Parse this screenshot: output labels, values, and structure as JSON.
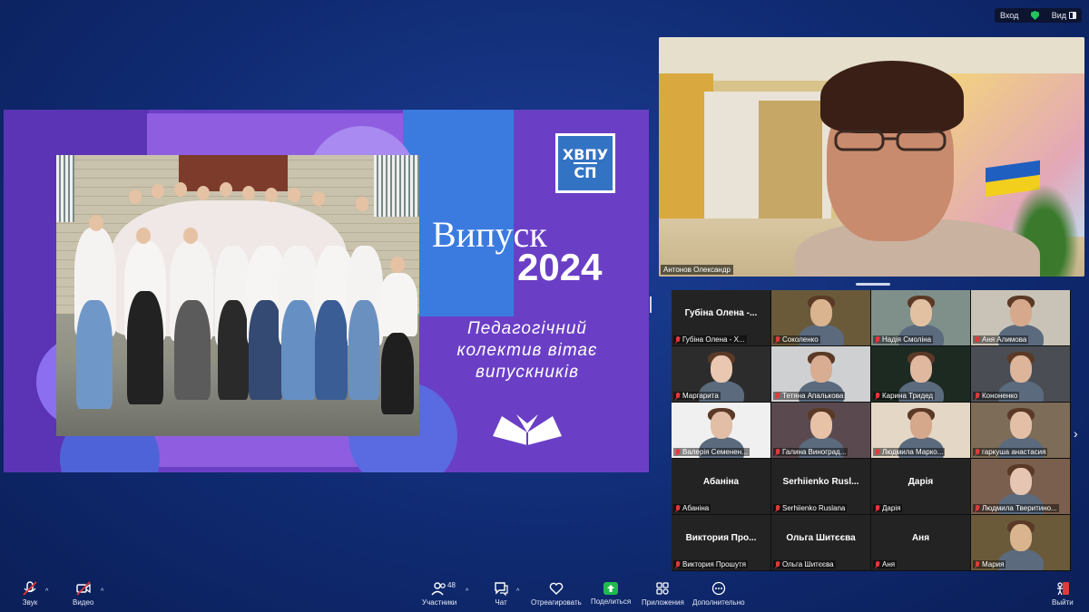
{
  "status_bar": {
    "login_label": "Вход",
    "view_label": "Вид"
  },
  "slide": {
    "logo_line1": "ХВПУ",
    "logo_line2": "СП",
    "title": "Випуск",
    "year": "2024",
    "tagline_1": "Педагогічний",
    "tagline_2": "колектив вітає",
    "tagline_3": "випускників"
  },
  "speaker": {
    "name": "Антонов Олександр"
  },
  "gallery": {
    "tiles": [
      {
        "display": "Губіна Олена -...",
        "caption": "Губіна Олена - Х...",
        "has_video": false
      },
      {
        "display": "",
        "caption": "Соколенко",
        "has_video": true
      },
      {
        "display": "",
        "caption": "Надія Смоліна",
        "has_video": true
      },
      {
        "display": "",
        "caption": "Аня Алимова",
        "has_video": true
      },
      {
        "display": "",
        "caption": "Маргарита",
        "has_video": true
      },
      {
        "display": "",
        "caption": "Тетяна Апалькова",
        "has_video": true
      },
      {
        "display": "",
        "caption": "Карина Тридед",
        "has_video": true
      },
      {
        "display": "",
        "caption": "Кононенко",
        "has_video": true
      },
      {
        "display": "",
        "caption": "Валерія Семенен...",
        "has_video": true
      },
      {
        "display": "",
        "caption": "Галина Виноград...",
        "has_video": true
      },
      {
        "display": "",
        "caption": "Людмила Марко...",
        "has_video": true
      },
      {
        "display": "",
        "caption": "гаркуша анастасия",
        "has_video": true
      },
      {
        "display": "Абаніна",
        "caption": "Абаніна",
        "has_video": false
      },
      {
        "display": "Serhiienko Rusl...",
        "caption": "Serhiienko Ruslana",
        "has_video": false
      },
      {
        "display": "Дарія",
        "caption": "Дарія",
        "has_video": false
      },
      {
        "display": "",
        "caption": "Людмила Тверитино...",
        "has_video": true
      },
      {
        "display": "Виктория Про...",
        "caption": "Виктория Прошутя",
        "has_video": false
      },
      {
        "display": "Ольга Шитєєва",
        "caption": "Ольга Шитєєва",
        "has_video": false
      },
      {
        "display": "Аня",
        "caption": "Аня",
        "has_video": false
      },
      {
        "display": "",
        "caption": "Мария",
        "has_video": true
      }
    ]
  },
  "toolbar": {
    "audio": "Звук",
    "video": "Видео",
    "participants": "Участники",
    "participants_count": "48",
    "chat": "Чат",
    "react": "Отреагировать",
    "share": "Поделиться",
    "apps": "Приложения",
    "more": "Дополнительно",
    "leave": "Выйти"
  },
  "colors": {
    "share_green": "#1fba4f",
    "mute_red": "#e03a3a",
    "slide_purple": "#6a3fc6"
  }
}
